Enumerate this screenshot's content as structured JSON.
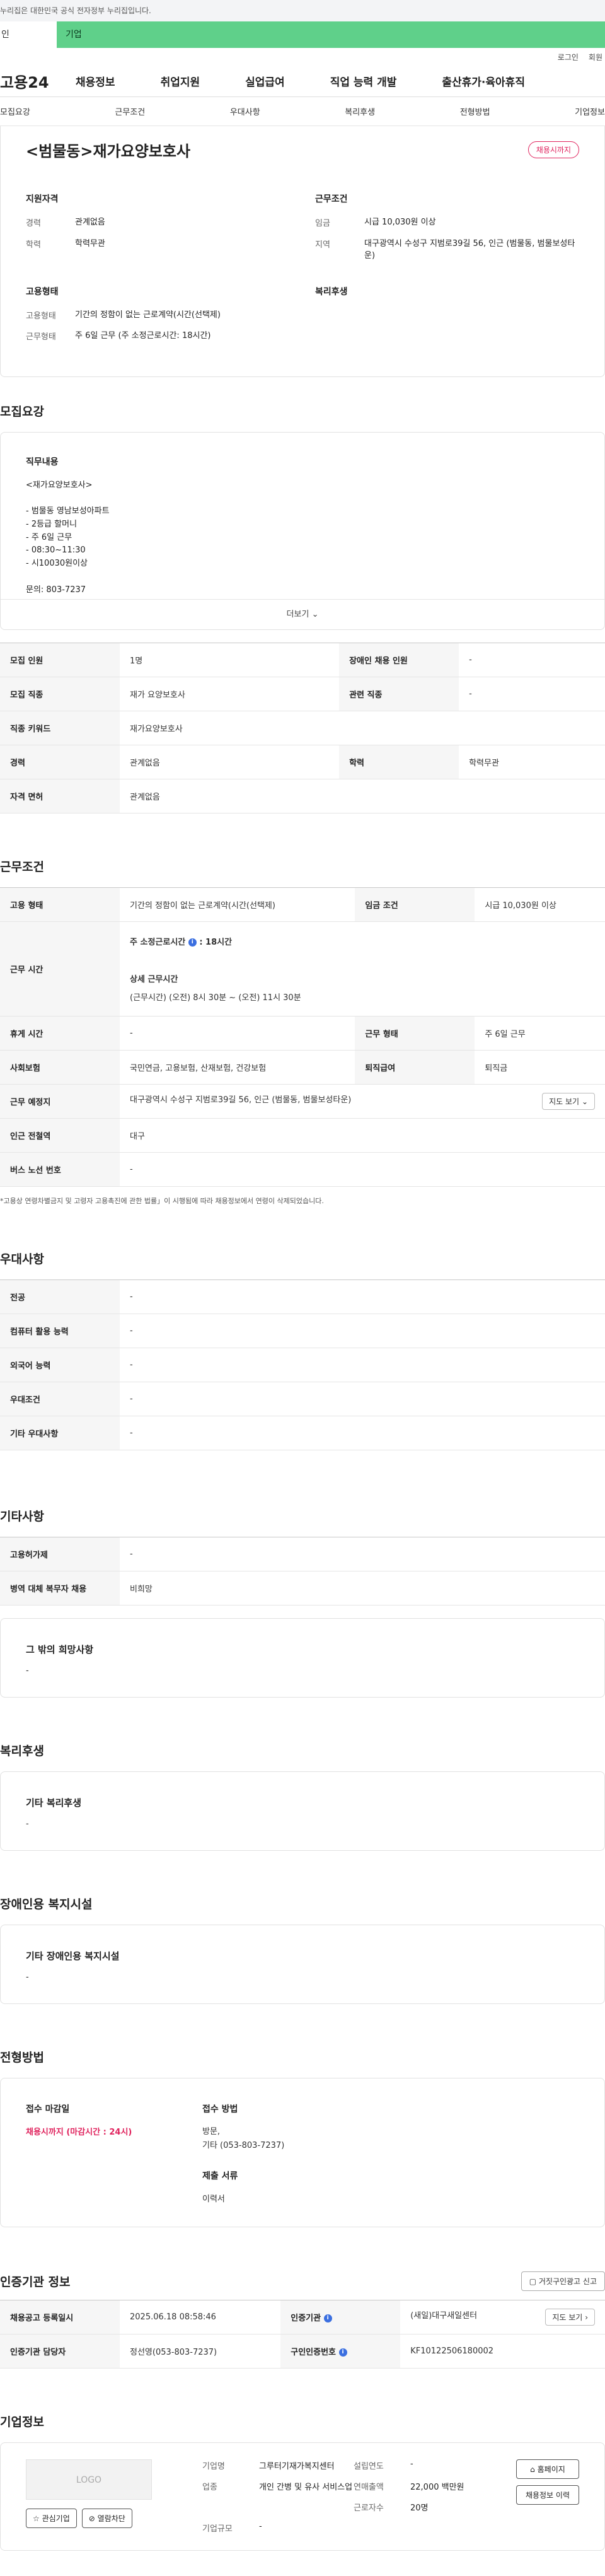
{
  "gov_banner": "누리집은 대한민국 공식 전자정부 누리집입니다.",
  "tabs": {
    "person": "인",
    "company": "기업"
  },
  "util": {
    "login": "로그인",
    "join": "회원"
  },
  "logo": "고용24",
  "gnb": [
    "채용정보",
    "취업지원",
    "실업급여",
    "직업 능력 개발",
    "출산휴가·육아휴직"
  ],
  "subnav": [
    "모집요강",
    "근무조건",
    "우대사항",
    "복리후생",
    "전형방법",
    "기업정보"
  ],
  "job": {
    "title": "<범물동>재가요양보호사",
    "status": "채용시까지"
  },
  "summary": {
    "qual_h": "지원자격",
    "career_k": "경력",
    "career_v": "관계없음",
    "edu_k": "학력",
    "edu_v": "학력무관",
    "cond_h": "근무조건",
    "wage_k": "임금",
    "wage_v": "시급 10,030원 이상",
    "region_k": "지역",
    "region_v": "대구광역시 수성구 지범로39길 56, 인근 (범물동, 범물보성타운)",
    "emp_h": "고용형태",
    "emptype_k": "고용형태",
    "emptype_v": "기간의 정함이 없는 근로계약(시간(선택제)",
    "worktype_k": "근무형태",
    "worktype_v": "주 6일 근무 (주 소정근로시간: 18시간)",
    "welfare_h": "복리후생"
  },
  "recruit": {
    "title": "모집요강",
    "desc_h": "직무내용",
    "desc": "<재가요양보호사>\n\n- 범물동 영남보성아파트\n- 2등급 할머니\n- 주 6일 근무\n- 08:30~11:30\n- 시10030원이상\n\n문의: 803-7237",
    "more": "더보기",
    "rows": [
      {
        "k1": "모집 인원",
        "v1": "1명",
        "k2": "장애인 채용 인원",
        "v2": "-"
      },
      {
        "k1": "모집 직종",
        "v1": "재가 요양보호사",
        "k2": "관련 직종",
        "v2": "-"
      },
      {
        "k1": "직종 키워드",
        "v1": "재가요양보호사",
        "k2": "",
        "v2": ""
      },
      {
        "k1": "경력",
        "v1": "관계없음",
        "k2": "학력",
        "v2": "학력무관"
      },
      {
        "k1": "자격 면허",
        "v1": "관계없음",
        "k2": "",
        "v2": ""
      }
    ]
  },
  "conditions": {
    "title": "근무조건",
    "emp_k": "고용 형태",
    "emp_v": "기간의 정함이 없는 근로계약(시간(선택제)",
    "wage_k": "임금 조건",
    "wage_v": "시급 10,030원 이상",
    "time_k": "근무 시간",
    "time_weekly": "주 소정근로시간",
    "time_weekly_v": ": 18시간",
    "time_detail_h": "상세 근무시간",
    "time_detail_v": "(근무시간) (오전) 8시 30분 ~ (오전) 11시 30분",
    "rest_k": "휴게 시간",
    "rest_v": "-",
    "worktype_k": "근무 형태",
    "worktype_v": "주 6일 근무",
    "ins_k": "사회보험",
    "ins_v": "국민연금, 고용보험, 산재보험, 건강보험",
    "sev_k": "퇴직급여",
    "sev_v": "퇴직금",
    "place_k": "근무 예정지",
    "place_v": "대구광역시 수성구 지범로39길 56, 인근 (범물동, 범물보성타운)",
    "map_btn": "지도 보기",
    "subway_k": "인근 전철역",
    "subway_v": "대구",
    "bus_k": "버스 노선 번호",
    "bus_v": "-",
    "note": "*고용상 연령차별금지 및 고령자 고용촉진에 관한 법률」이 시행됨에 따라 채용정보에서 연령이 삭제되었습니다."
  },
  "preference": {
    "title": "우대사항",
    "rows": [
      {
        "k": "전공",
        "v": "-"
      },
      {
        "k": "컴퓨터 활용 능력",
        "v": "-"
      },
      {
        "k": "외국어 능력",
        "v": "-"
      },
      {
        "k": "우대조건",
        "v": "-"
      },
      {
        "k": "기타 우대사항",
        "v": "-"
      }
    ]
  },
  "etc": {
    "title": "기타사항",
    "rows": [
      {
        "k": "고용허가제",
        "v": "-"
      },
      {
        "k": "병역 대체 복무자 채용",
        "v": "비희망"
      }
    ],
    "box_h": "그 밖의 희망사항",
    "box_v": "-"
  },
  "welfare": {
    "title": "복리후생",
    "box_h": "기타 복리후생",
    "box_v": "-"
  },
  "disabled": {
    "title": "장애인용 복지시설",
    "box_h": "기타 장애인용 복지시설",
    "box_v": "-"
  },
  "apply": {
    "title": "전형방법",
    "deadline_h": "접수 마감일",
    "deadline_v": "채용시까지 (마감시간 : 24시)",
    "method_h": "접수 방법",
    "method_v": "방문,\n기타 (053-803-7237)",
    "docs_h": "제출 서류",
    "docs_v": "이력서"
  },
  "agency": {
    "title": "인증기관 정보",
    "report_btn": "거짓구인광고 신고",
    "reg_k": "채용공고 등록일시",
    "reg_v": "2025.06.18 08:58:46",
    "org_k": "인증기관",
    "org_v": "(새일)대구새일센터",
    "map_btn": "지도 보기",
    "manager_k": "인증기관 담당자",
    "manager_v": "정선영(053-803-7237)",
    "num_k": "구인인증번호",
    "num_v": "KF10122506180002"
  },
  "company": {
    "title": "기업정보",
    "logo": "LOGO",
    "fav_btn": "관심기업",
    "block_btn": "열람차단",
    "name_k": "기업명",
    "name_v": "그루터기재가복지센터",
    "year_k": "설립연도",
    "year_v": "-",
    "biz_k": "업종",
    "biz_v": "개인 간병 및 유사 서비스업",
    "sales_k": "연매출액",
    "sales_v": "22,000 백만원",
    "emp_k": "근로자수",
    "emp_v": "20명",
    "size_k": "기업규모",
    "size_v": "-",
    "home_btn": "홈페이지",
    "jobs_btn": "채용정보 이력"
  }
}
